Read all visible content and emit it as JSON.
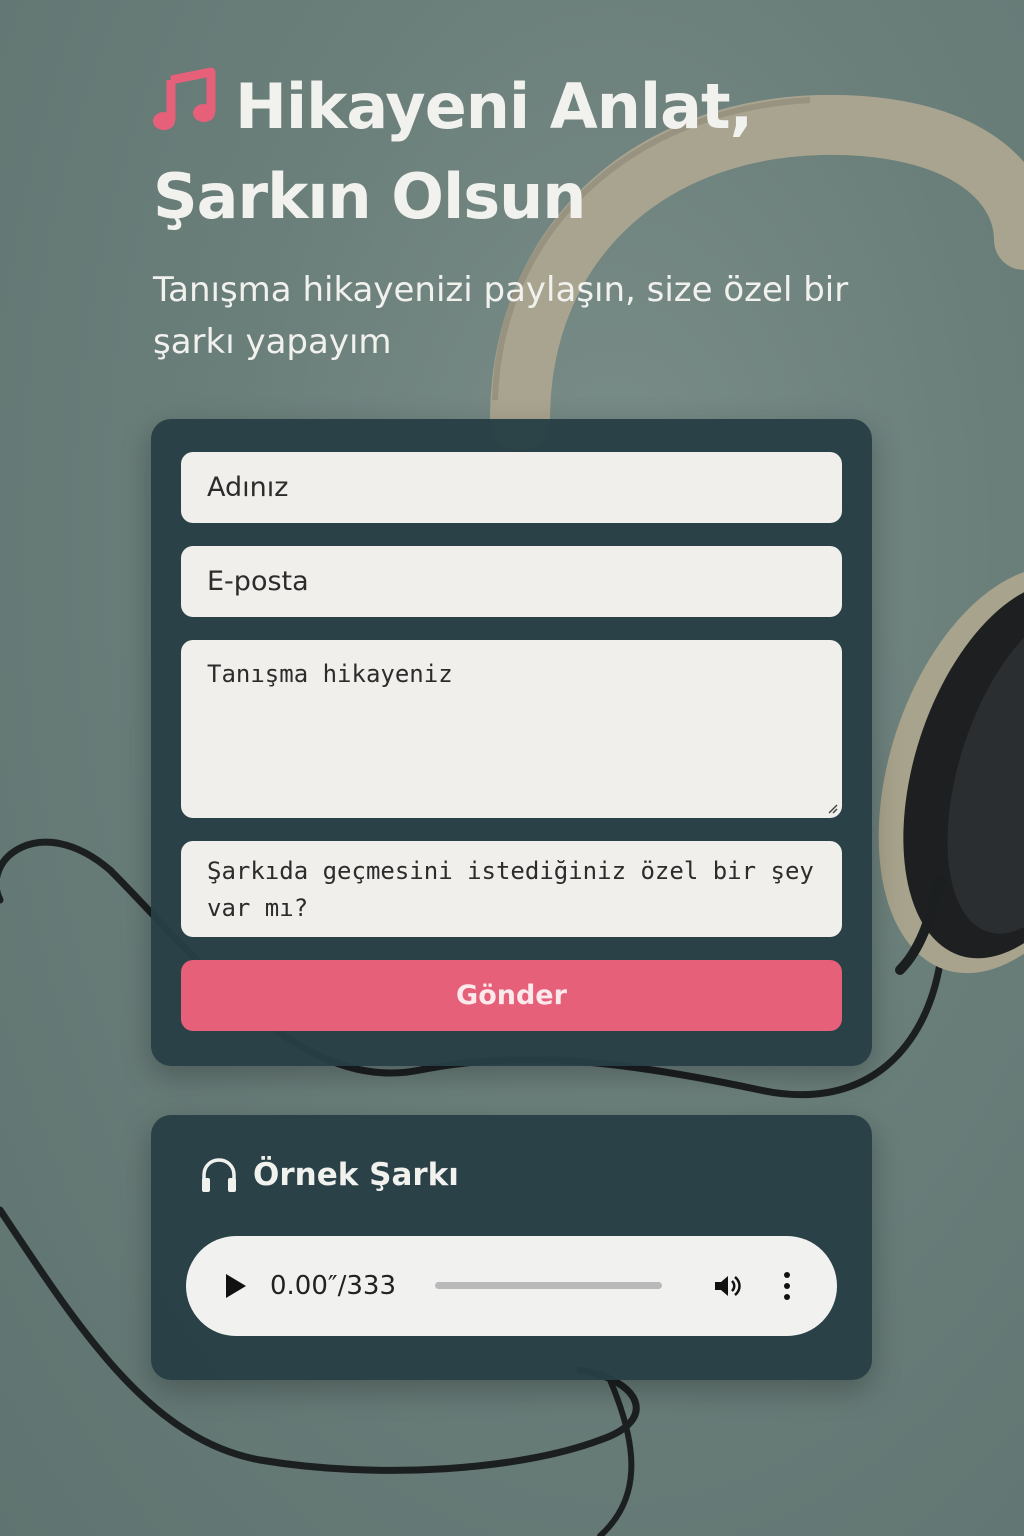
{
  "hero": {
    "title_line1": "Hikayeni Anlat,",
    "title_line2": "Şarkın Olsun",
    "subtitle": "Tanışma hikayenizi paylaşın, size özel bir şarkı yapayım",
    "icon": "music-note-icon"
  },
  "form": {
    "name_placeholder": "Adınız",
    "email_placeholder": "E-posta",
    "story_placeholder": "Tanışma hikayeniz",
    "special_placeholder": "Şarkıda geçmesini istediğiniz özel bir şey var mı?",
    "submit_label": "Gönder"
  },
  "sample": {
    "title": "Örnek Şarkı",
    "icon": "headphones-icon",
    "player": {
      "time": "0.00″/333",
      "progress": 0
    }
  },
  "colors": {
    "accent": "#e6607a",
    "card": "#273e45",
    "field": "#f0efeb",
    "text_light": "#f1f1ee"
  }
}
